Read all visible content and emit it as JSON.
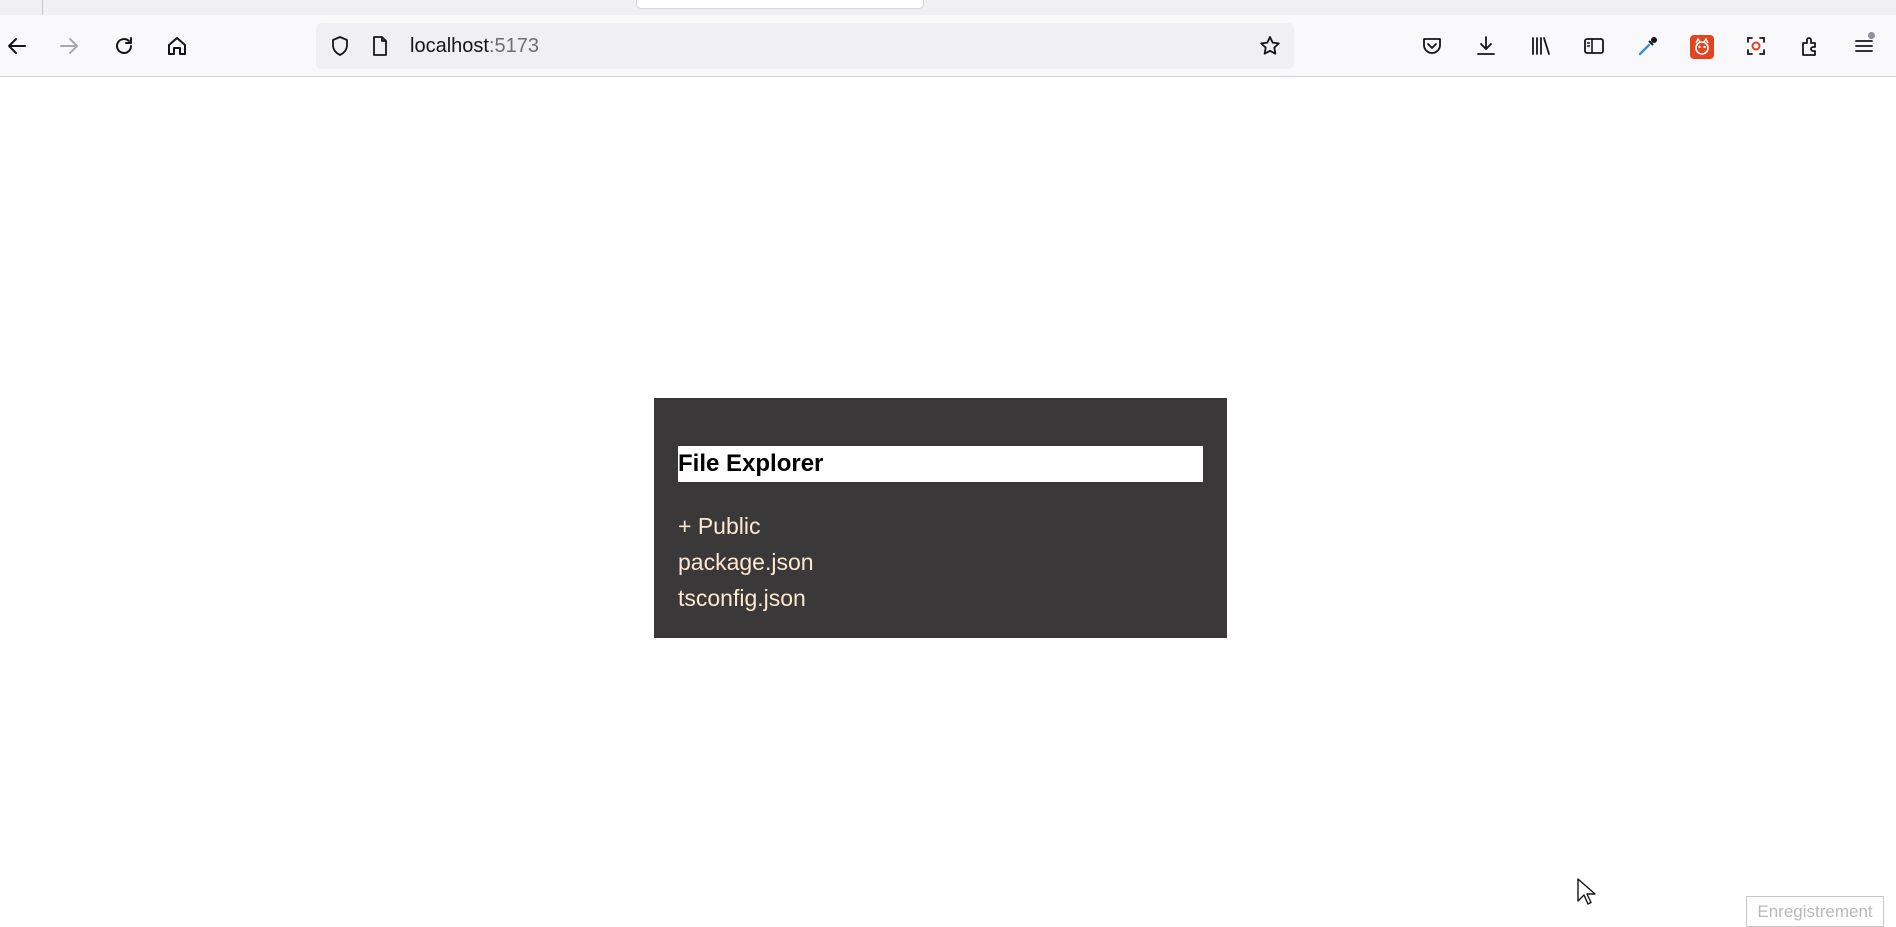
{
  "browser": {
    "url_host": "localhost",
    "url_port": ":5173",
    "icons": {
      "back": "arrow-left-icon",
      "forward": "arrow-right-icon",
      "reload": "reload-icon",
      "home": "home-icon",
      "tracking_protection": "shield-icon",
      "page_info": "page-icon",
      "bookmark": "star-icon",
      "pocket": "pocket-icon",
      "downloads": "download-icon",
      "library": "library-icon",
      "sidebar": "sidebar-icon",
      "eyedropper": "eyedropper-icon",
      "extension_fox": "fox-extension-icon",
      "screenshot": "screenshot-icon",
      "extensions": "puzzle-icon",
      "menu": "hamburger-menu-icon"
    }
  },
  "explorer": {
    "title": "File Explorer",
    "items": [
      {
        "label": "+ Public",
        "kind": "folder"
      },
      {
        "label": "package.json",
        "kind": "file"
      },
      {
        "label": "tsconfig.json",
        "kind": "file"
      }
    ]
  },
  "overlay": {
    "recording_label": "Enregistrement"
  },
  "colors": {
    "panel_bg": "#3a3839",
    "item_text": "#fde8d0",
    "title_bg": "#ffffff",
    "title_text": "#000000"
  }
}
